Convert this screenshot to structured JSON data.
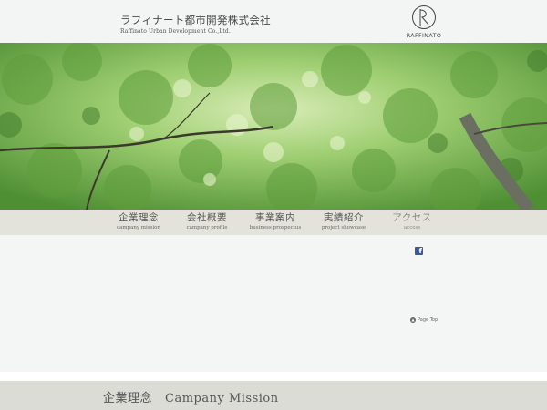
{
  "header": {
    "company_name_jp": "ラフィナート都市開発株式会社",
    "company_name_en": "Raffinato Urban Development Co.,Ltd.",
    "logo_text": "RAFFINATO"
  },
  "nav": {
    "items": [
      {
        "label_jp": "企業理念",
        "label_en": "campany mission"
      },
      {
        "label_jp": "会社概要",
        "label_en": "campany profile"
      },
      {
        "label_jp": "事業案内",
        "label_en": "business prospectus"
      },
      {
        "label_jp": "実績紹介",
        "label_en": "project showcase"
      },
      {
        "label_jp": "アクセス",
        "label_en": "access"
      }
    ]
  },
  "social": {
    "facebook_icon": "facebook-icon",
    "facebook_glyph": "f"
  },
  "page_top": {
    "label": "Page Top",
    "icon": "arrow-up-circle-icon"
  },
  "section": {
    "title_jp": "企業理念",
    "title_en": "Campany Mission"
  },
  "colors": {
    "background": "#f3f4f4",
    "nav_bar": "#e3e3dc",
    "section_bar": "#dcdcd6",
    "facebook": "#3b5998"
  }
}
